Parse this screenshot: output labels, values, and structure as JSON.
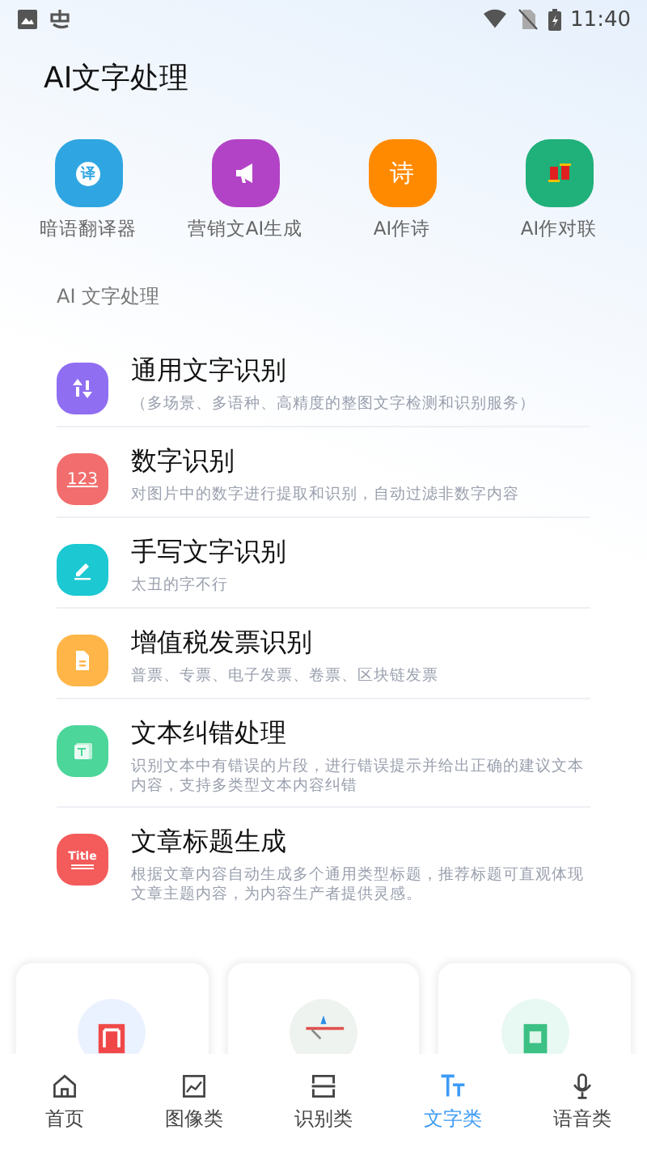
{
  "status_bar": {
    "time": "11:40"
  },
  "title": "AI文字处理",
  "quick_tools": [
    {
      "label": "暗语翻译器",
      "kind": "translate",
      "glyph": "译",
      "color": "#2fa6e2"
    },
    {
      "label": "营销文AI生成",
      "kind": "megaphone",
      "color": "#b343c6"
    },
    {
      "label": "AI作诗",
      "kind": "text",
      "glyph": "诗",
      "color": "#ff8a00"
    },
    {
      "label": "AI作对联",
      "kind": "couplet",
      "color": "#20b07a"
    }
  ],
  "section_title": "AI 文字处理",
  "features": [
    {
      "title": "通用文字识别",
      "desc": "（多场景、多语种、高精度的整图文字检测和识别服务）",
      "kind": "sort",
      "color": "#8f6ef2"
    },
    {
      "title": "数字识别",
      "desc": "对图片中的数字进行提取和识别，自动过滤非数字内容",
      "kind": "digits",
      "glyph": "123",
      "color": "#f26d6d"
    },
    {
      "title": "手写文字识别",
      "desc": "太丑的字不行",
      "kind": "pen",
      "color": "#1cc8d2"
    },
    {
      "title": "增值税发票识别",
      "desc": "普票、专票、电子发票、卷票、区块链发票",
      "kind": "doc",
      "color": "#ffb547"
    },
    {
      "title": "文本纠错处理",
      "desc": "识别文本中有错误的片段，进行错误提示并给出正确的建议文本内容，支持多类型文本内容纠错",
      "kind": "textdoc",
      "color": "#4cd69a"
    },
    {
      "title": "文章标题生成",
      "desc": "根据文章内容自动生成多个通用类型标题，推荐标题可直观体现文章主题内容，为内容生产者提供灵感。",
      "kind": "title",
      "glyph": "Title",
      "color": "#f45b5b"
    }
  ],
  "cards": [
    {
      "kind": "book",
      "color": "#eaf1ff"
    },
    {
      "kind": "boat",
      "color": "#eef3ef"
    },
    {
      "kind": "square",
      "color": "#e8f8f2"
    }
  ],
  "nav": [
    {
      "label": "首页",
      "kind": "home",
      "selected": false
    },
    {
      "label": "图像类",
      "kind": "image",
      "selected": false
    },
    {
      "label": "识别类",
      "kind": "scan",
      "selected": false
    },
    {
      "label": "文字类",
      "kind": "text",
      "selected": true
    },
    {
      "label": "语音类",
      "kind": "mic",
      "selected": false
    }
  ]
}
